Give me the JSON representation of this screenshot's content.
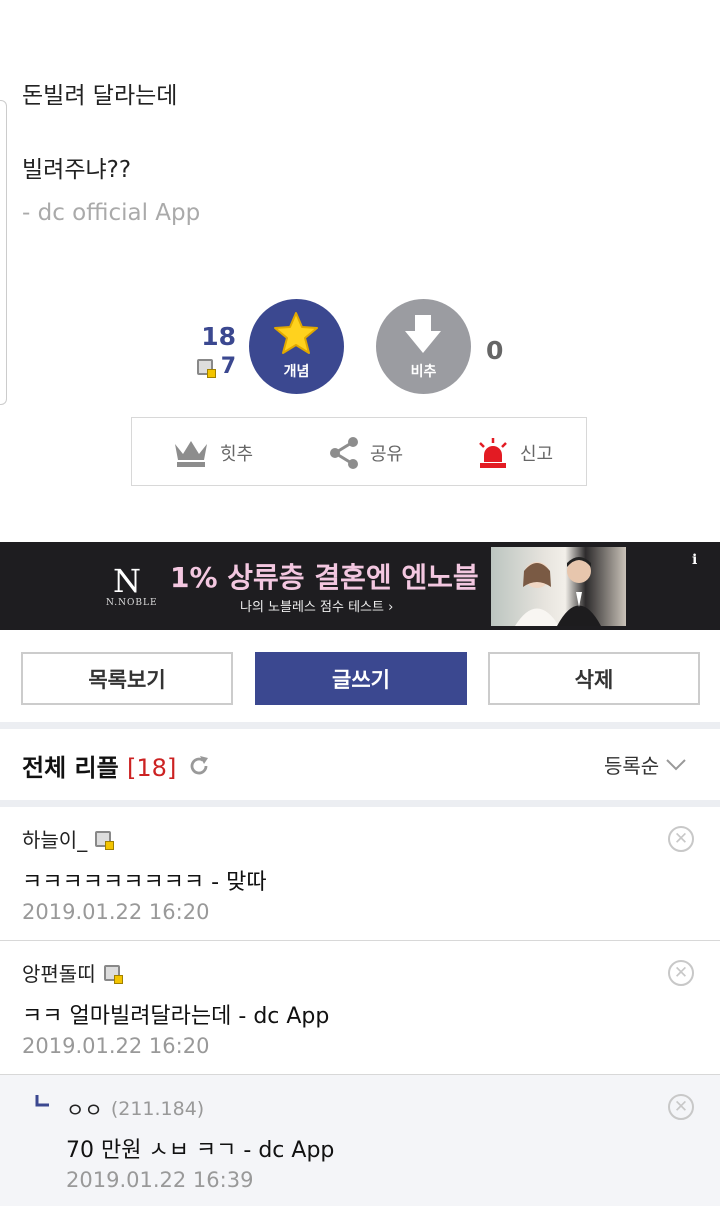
{
  "post": {
    "line1": "돈빌려 달라는데",
    "line2": "빌려주냐??",
    "signature": "- dc official App"
  },
  "vote": {
    "up_count": "18",
    "fixed_count": "7",
    "up_label": "개념",
    "down_label": "비추",
    "down_count": "0"
  },
  "actions": {
    "hit": "힛추",
    "share": "공유",
    "report": "신고"
  },
  "ad": {
    "logo_letter": "N",
    "logo_text": "N.NOBLE",
    "headline": "1% 상류층 결혼엔 엔노블",
    "sub": "나의 노블레스 점수 테스트 ›",
    "info": "i"
  },
  "buttons": {
    "list": "목록보기",
    "write": "글쓰기",
    "delete": "삭제"
  },
  "replies": {
    "title": "전체 리플",
    "count": "[18]",
    "sort": "등록순"
  },
  "comments": [
    {
      "nick": "하늘이_",
      "text": "ㅋㅋㅋㅋㅋㅋㅋㅋㅋ - 맞따",
      "date": "2019.01.22 16:20"
    },
    {
      "nick": "앙편돌띠",
      "text": "ㅋㅋ 얼마빌려달라는데 - dc App",
      "date": "2019.01.22 16:20"
    },
    {
      "nick": "ㅇㅇ",
      "ip": "(211.184)",
      "text": "70 만원 ㅅㅂ ㅋㄱ - dc App",
      "date": "2019.01.22 16:39"
    }
  ],
  "colors": {
    "accent": "#3b4890",
    "down": "#9b9ca1",
    "reply_count": "#cc2222"
  }
}
